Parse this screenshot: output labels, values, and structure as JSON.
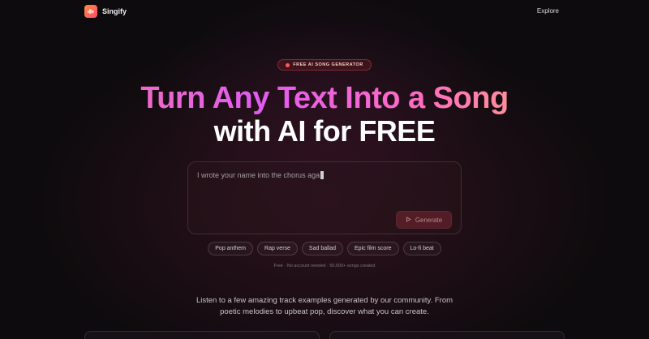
{
  "nav": {
    "brand": "Singify",
    "explore_label": "Explore"
  },
  "hero": {
    "badge": "FREE AI SONG GENERATOR",
    "headline_line1": "Turn Any Text Into a Song",
    "headline_line2": "with AI for FREE"
  },
  "composer": {
    "prompt_value": "I wrote your name into the chorus aga",
    "generate_label": "Generate"
  },
  "chips": [
    {
      "label": "Pop anthem"
    },
    {
      "label": "Rap verse"
    },
    {
      "label": "Sad ballad"
    },
    {
      "label": "Epic film score"
    },
    {
      "label": "Lo-fi beat"
    }
  ],
  "note": "Free · No account needed · 50,000+ songs created",
  "blurb": "Listen to a few amazing track examples generated by our community. From poetic melodies to upbeat pop, discover what you can create.",
  "colors": {
    "background": "#0d0b0d",
    "accent": "#ff5a5a",
    "logo_gradient_start": "#ff8a3d",
    "logo_gradient_end": "#ff4d6d"
  },
  "icons": {
    "logo": "sound-wave-icon",
    "badge": "dot-icon",
    "generate": "play-icon"
  }
}
